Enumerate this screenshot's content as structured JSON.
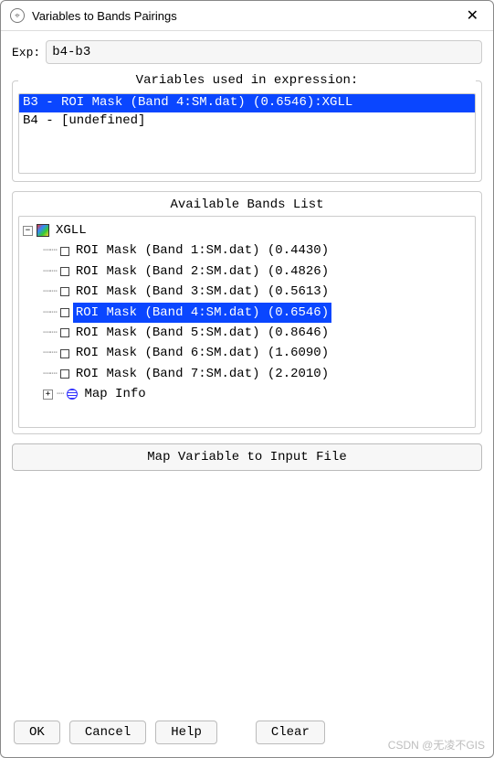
{
  "window": {
    "title": "Variables to Bands Pairings"
  },
  "exp": {
    "label": "Exp:",
    "value": "b4-b3"
  },
  "variables": {
    "legend": "Variables used in expression:",
    "items": [
      {
        "text": "B3 - ROI Mask (Band 4:SM.dat) (0.6546):XGLL",
        "selected": true
      },
      {
        "text": "B4 - [undefined]",
        "selected": false
      }
    ]
  },
  "bands": {
    "header": "Available Bands List",
    "root": "XGLL",
    "items": [
      {
        "label": "ROI Mask (Band 1:SM.dat) (0.4430)",
        "selected": false
      },
      {
        "label": "ROI Mask (Band 2:SM.dat) (0.4826)",
        "selected": false
      },
      {
        "label": "ROI Mask (Band 3:SM.dat) (0.5613)",
        "selected": false
      },
      {
        "label": "ROI Mask (Band 4:SM.dat) (0.6546)",
        "selected": true
      },
      {
        "label": "ROI Mask (Band 5:SM.dat) (0.8646)",
        "selected": false
      },
      {
        "label": "ROI Mask (Band 6:SM.dat) (1.6090)",
        "selected": false
      },
      {
        "label": "ROI Mask (Band 7:SM.dat) (2.2010)",
        "selected": false
      }
    ],
    "mapinfo": "Map Info"
  },
  "buttons": {
    "map_variable": "Map Variable to Input File",
    "ok": "OK",
    "cancel": "Cancel",
    "help": "Help",
    "clear": "Clear"
  },
  "watermark": "CSDN @无凌不GIS"
}
